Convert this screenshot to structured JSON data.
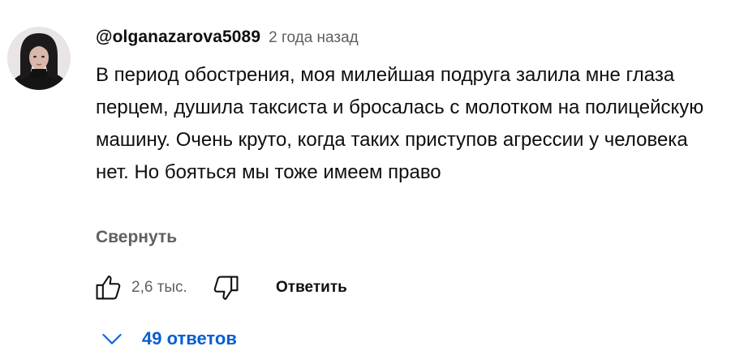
{
  "comment": {
    "author": "@olganazarova5089",
    "published": "2 года назад",
    "text": "В период обострения, моя милейшая подруга залила мне глаза перцем, душила таксиста и бросалась с молотком на полицейскую машину. Очень круто, когда таких приступов агрессии у человека нет. Но бояться мы тоже имеем право",
    "collapse_label": "Свернуть",
    "like_count": "2,6 тыс.",
    "reply_label": "Ответить",
    "replies_label": "49 ответов"
  },
  "icons": {
    "avatar": "user-avatar-photo",
    "like": "thumb-up-icon",
    "dislike": "thumb-down-icon",
    "replies": "chevron-down-icon"
  },
  "colors": {
    "text": "#0f0f0f",
    "secondary_text": "#606060",
    "link_blue": "#065fd4",
    "background": "#ffffff"
  }
}
